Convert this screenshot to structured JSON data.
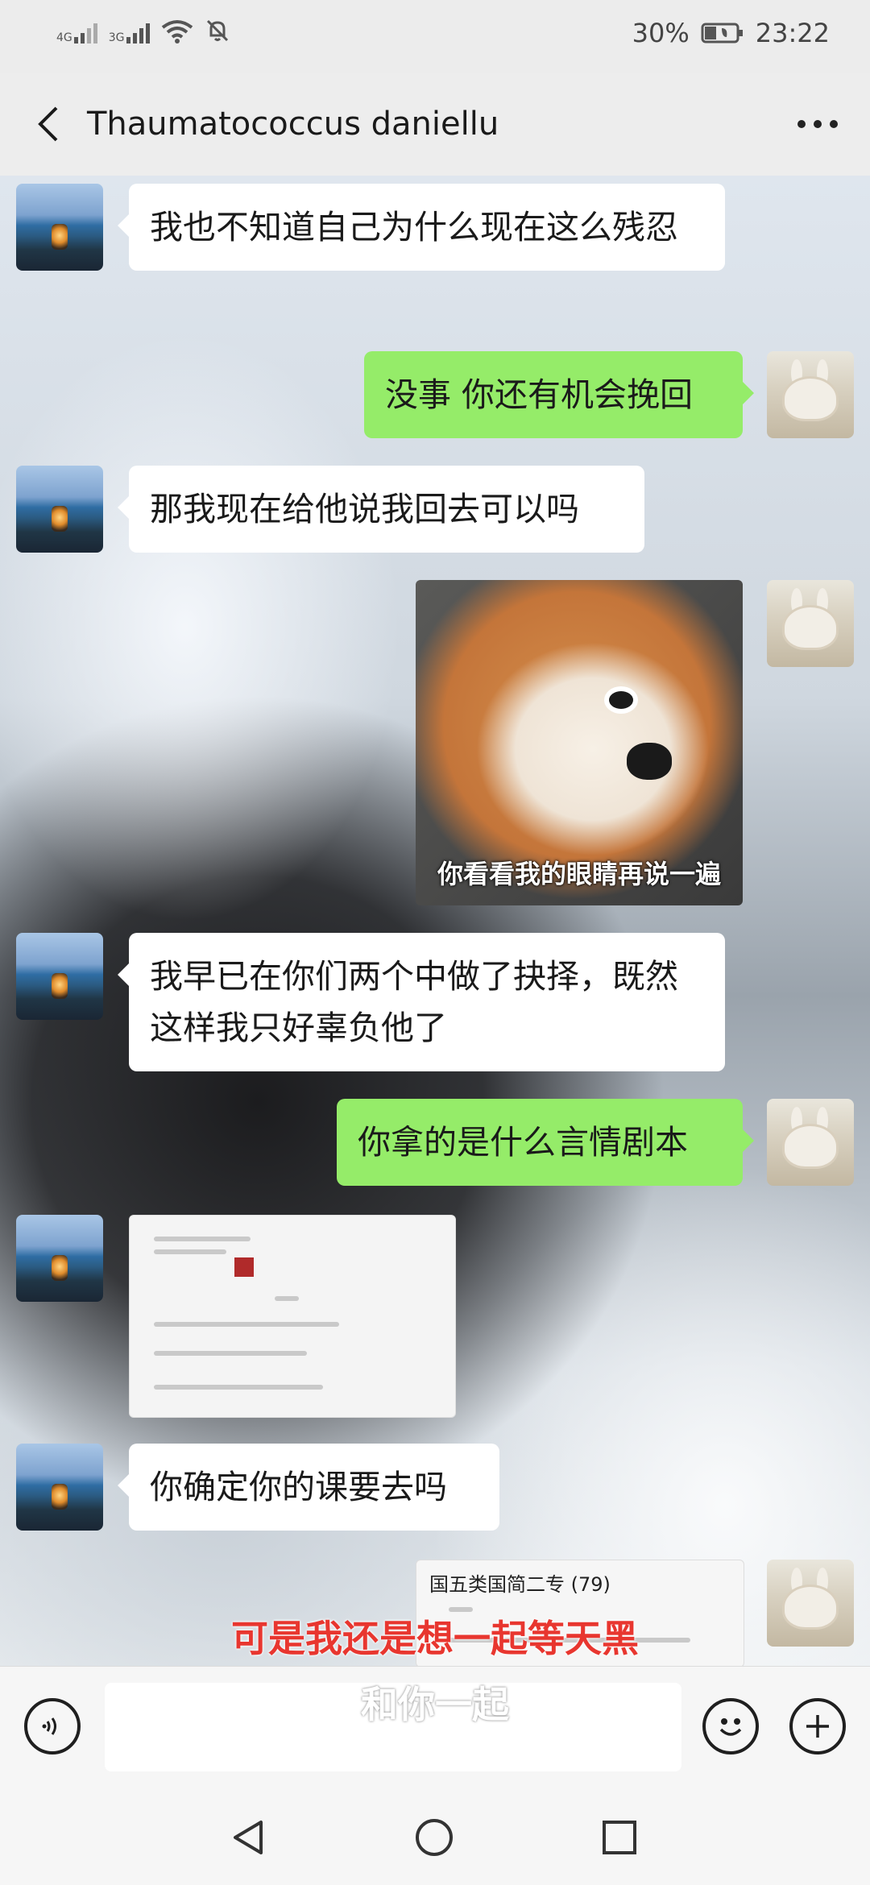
{
  "status": {
    "signal1": "4G",
    "signal2": "3G",
    "battery": "30%",
    "time": "23:22"
  },
  "header": {
    "title": "Thaumatococcus daniellu"
  },
  "messages": [
    {
      "side": "left",
      "type": "text",
      "text": "我也不知道自己为什么现在这么残忍"
    },
    {
      "side": "right",
      "type": "text",
      "text": "没事 你还有机会挽回"
    },
    {
      "side": "left",
      "type": "text",
      "text": "那我现在给他说我回去可以吗"
    },
    {
      "side": "right",
      "type": "image",
      "caption": "你看看我的眼睛再说一遍"
    },
    {
      "side": "left",
      "type": "text",
      "text": "我早已在你们两个中做了抉择，既然这样我只好辜负他了"
    },
    {
      "side": "right",
      "type": "text",
      "text": "你拿的是什么言情剧本"
    },
    {
      "side": "left",
      "type": "image",
      "caption": ""
    },
    {
      "side": "left",
      "type": "text",
      "text": "你确定你的课要去吗"
    },
    {
      "side": "right",
      "type": "image",
      "caption": "国五类国简二专 (79)"
    }
  ],
  "overlay": {
    "lyric_line1": "可是我还是想一起等天黑",
    "lyric_line2": "和你一起"
  },
  "input": {
    "value": "",
    "placeholder": ""
  },
  "icons": {
    "back": "back-arrow-icon",
    "more": "more-dots-icon",
    "voice": "voice-icon",
    "emoji": "emoji-icon",
    "plus": "plus-icon",
    "nav_back": "nav-back-icon",
    "nav_home": "nav-home-icon",
    "nav_recent": "nav-recent-icon"
  },
  "colors": {
    "bubble_right": "#95ec69",
    "bubble_left": "#ffffff",
    "lyric_red": "#e8362f"
  }
}
